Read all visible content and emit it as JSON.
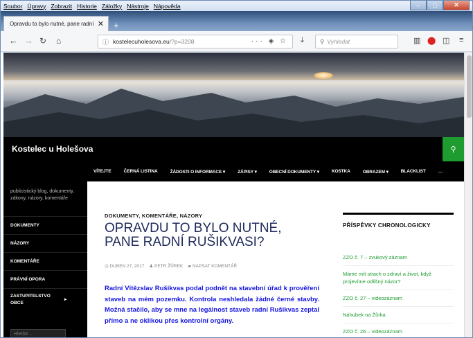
{
  "browser": {
    "menu": [
      "Soubor",
      "Úpravy",
      "Zobrazit",
      "Historie",
      "Záložky",
      "Nástroje",
      "Nápověda"
    ],
    "tab_title": "Opravdu to bylo nutné, pane radní",
    "tab_close": "✕",
    "new_tab": "+",
    "url_host": "kostelecuholesova.eu",
    "url_path": "/?p=3208",
    "search_placeholder": "Vyhledat"
  },
  "site": {
    "title": "Kostelec u Holešova",
    "nav": [
      "VÍTEJTE",
      "ČERNÁ LISTINA",
      "ŽÁDOSTI O INFORMACE ▾",
      "ZÁPISY ▾",
      "OBECNÍ DOKUMENTY ▾",
      "KOSTKA",
      "OBRAZEM ▾",
      "BLACKLIST",
      "…"
    ],
    "tagline": "publicistický blog, dokumenty, zákony, názory, komentáře",
    "left_menu": [
      "DOKUMENTY",
      "NÁZORY",
      "KOMENTÁŘE",
      "PRÁVNÍ OPORA",
      "ZASTUPITELSTVO OBCE"
    ],
    "left_menu_arrow": "▸",
    "search_placeholder": "Hledat …"
  },
  "post": {
    "categories": "DOKUMENTY, KOMENTÁŘE, NÁZORY",
    "title": "OPRAVDU TO BYLO NUTNÉ, PANE RADNÍ RUŠIKVASI?",
    "date": "DUBEN 27, 2017",
    "author": "PETR ŽŮREK",
    "comment": "NAPSAT KOMENTÁŘ",
    "excerpt": "Radní Vítězslav Rušikvas podal podnět na stavební úřad k prověření staveb na mém pozemku. Kontrola neshledala žádné černé stavby. Možná stačilo, aby se mne na legálnost staveb radní Rušikvas zeptal přímo a ne oklikou přes kontrolní orgány."
  },
  "sidebar": {
    "title": "PŘÍSPĚVKY CHRONOLOGICKY",
    "links": [
      "ZZO č. 7 – zvukový záznam",
      "Máme mít strach o zdraví a život, když projevíme odlišný názor?",
      "ZZO č. 27 – videozáznam",
      "Náhubek na Žůrka",
      "ZZO č. 26 – videozáznam"
    ]
  },
  "colors": {
    "accent": "#1e9c2f",
    "title_blue": "#1e2a5a",
    "excerpt_blue": "#1515e0"
  }
}
